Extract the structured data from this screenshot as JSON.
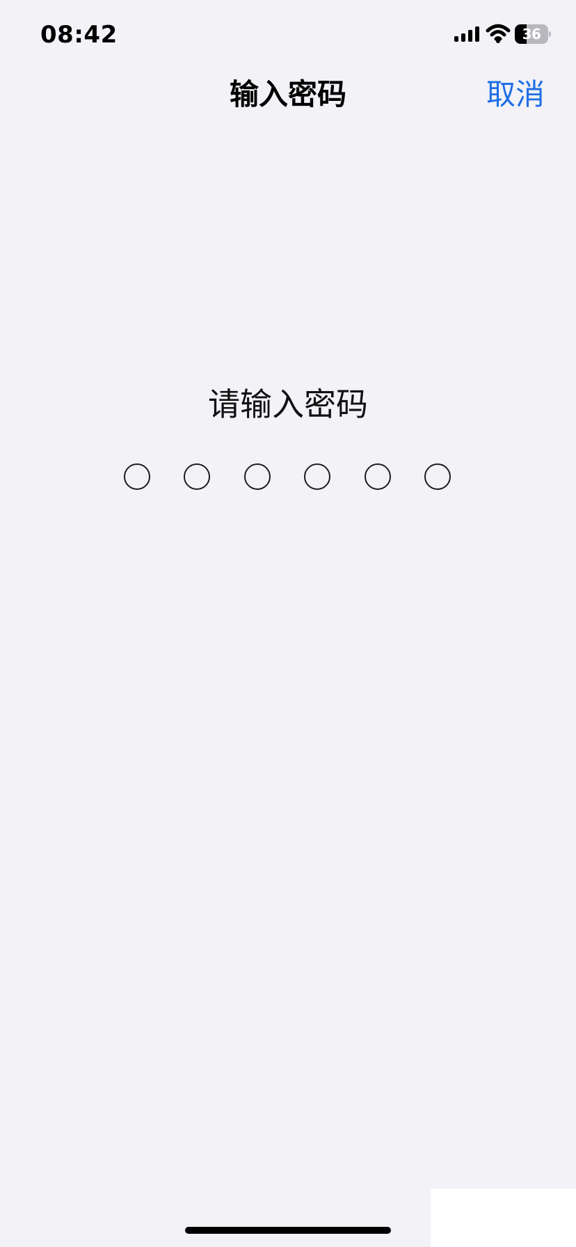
{
  "status_bar": {
    "time": "08:42",
    "battery_level": "36",
    "battery_fraction": 0.36,
    "icons": {
      "signal": "signal-icon",
      "wifi": "wifi-icon",
      "battery": "battery-icon"
    }
  },
  "navigation": {
    "title": "输入密码",
    "cancel_label": "取消"
  },
  "passcode": {
    "prompt": "请输入密码",
    "length": 6,
    "entered_count": 0
  },
  "colors": {
    "background": "#f2f2f7",
    "accent": "#1f6fe5",
    "text": "#000000"
  }
}
